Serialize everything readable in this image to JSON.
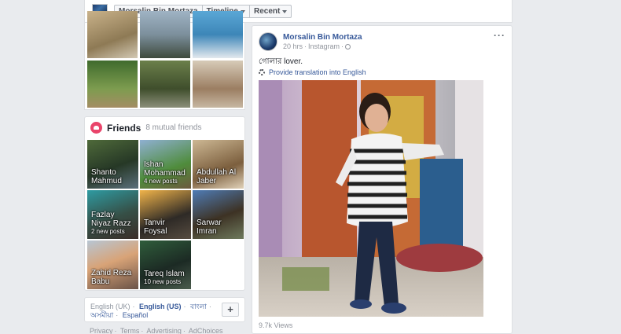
{
  "header": {
    "profile_name": "Morsalin Bin Mortaza",
    "timeline_label": "Timeline",
    "recent_label": "Recent"
  },
  "friends": {
    "title": "Friends",
    "mutual": "8 mutual friends",
    "tiles": [
      {
        "name": "Shanto Mahmud",
        "sub": ""
      },
      {
        "name": "Ishan Mohammad",
        "sub": "4 new posts"
      },
      {
        "name": "Abdullah Al Jaber",
        "sub": ""
      },
      {
        "name": "Fazlay Niyaz Razz",
        "sub": "2 new posts"
      },
      {
        "name": "Tanvir Foysal",
        "sub": ""
      },
      {
        "name": "Sarwar Imran",
        "sub": ""
      },
      {
        "name": "Zahid Reza Babu",
        "sub": ""
      },
      {
        "name": "Tareq Islam",
        "sub": "10 new posts"
      }
    ]
  },
  "languages": {
    "items": [
      "English (UK)",
      "English (US)",
      "বাংলা",
      "অসমীয়া",
      "Español"
    ],
    "add_label": "+"
  },
  "footer": {
    "links": [
      "Privacy",
      "Terms",
      "Advertising",
      "AdChoices"
    ]
  },
  "post": {
    "author": "Morsalin Bin Mortaza",
    "time": "20 hrs",
    "source": "Instagram",
    "text": "গোলার lover.",
    "translate_label": "Provide translation into English",
    "views": "9.7k Views",
    "more_label": "···"
  }
}
